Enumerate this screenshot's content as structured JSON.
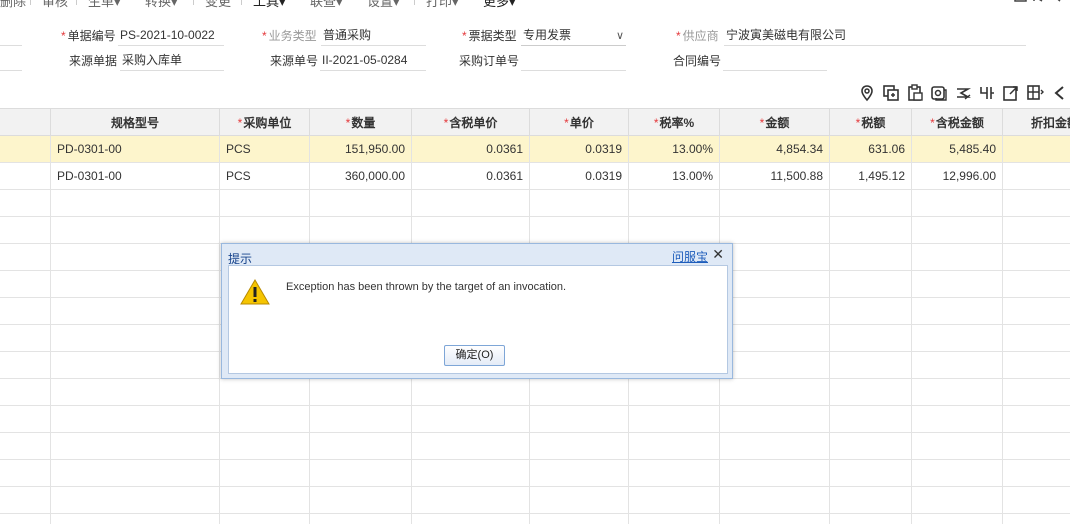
{
  "toolbar": {
    "items": [
      "删除",
      "审核",
      "生单▾",
      "转换▾",
      "变更",
      "工具▾",
      "联查▾",
      "设置▾",
      "打印▾",
      "更多▾"
    ]
  },
  "header": {
    "doc_no_label": "单据编号",
    "doc_no": "PS-2021-10-0022",
    "biz_type_label": "业务类型",
    "biz_type": "普通采购",
    "invoice_type_label": "票据类型",
    "invoice_type": "专用发票",
    "supplier_label": "供应商",
    "supplier": "宁波寅美磁电有限公司",
    "source_doc_label": "来源单据",
    "source_doc": "采购入库单",
    "source_no_label": "来源单号",
    "source_no": "II-2021-05-0284",
    "po_no_label": "采购订单号",
    "po_no": "",
    "contract_no_label": "合同编号",
    "contract_no": ""
  },
  "grid": {
    "columns": [
      {
        "label": "",
        "required": false
      },
      {
        "label": "规格型号",
        "required": false
      },
      {
        "label": "采购单位",
        "required": true
      },
      {
        "label": "数量",
        "required": true
      },
      {
        "label": "含税单价",
        "required": true
      },
      {
        "label": "单价",
        "required": true
      },
      {
        "label": "税率%",
        "required": true
      },
      {
        "label": "金额",
        "required": true
      },
      {
        "label": "税额",
        "required": true
      },
      {
        "label": "含税金额",
        "required": true
      },
      {
        "label": "折扣金额",
        "required": false
      }
    ],
    "rows": [
      [
        "",
        "PD-0301-00",
        "PCS",
        "151,950.00",
        "0.0361",
        "0.0319",
        "13.00%",
        "4,854.34",
        "631.06",
        "5,485.40",
        ""
      ],
      [
        "",
        "PD-0301-00",
        "PCS",
        "360,000.00",
        "0.0361",
        "0.0319",
        "13.00%",
        "11,500.88",
        "1,495.12",
        "12,996.00",
        ""
      ]
    ]
  },
  "dialog": {
    "title": "提示",
    "help_link": "问服宝",
    "close": "✕",
    "message": "Exception has been thrown by the target of an invocation.",
    "ok_label": "确定(O)"
  },
  "icons": [
    "location-icon",
    "copy-row-icon",
    "paste-row-icon",
    "batch-icon",
    "formula-icon",
    "filter-icon",
    "export-icon",
    "grid-settings-icon"
  ]
}
